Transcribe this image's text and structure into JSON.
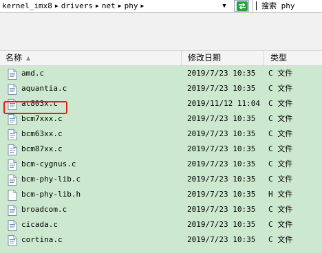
{
  "breadcrumb": [
    "kernel_imx8",
    "drivers",
    "net",
    "phy"
  ],
  "search": {
    "value": "搜索 phy"
  },
  "columns": {
    "name": "名称",
    "date": "修改日期",
    "type": "类型"
  },
  "files": [
    {
      "name": "amd.c",
      "date": "2019/7/23 10:35",
      "type": "C 文件",
      "icon": "c-file-icon"
    },
    {
      "name": "aquantia.c",
      "date": "2019/7/23 10:35",
      "type": "C 文件",
      "icon": "c-file-icon"
    },
    {
      "name": "at803x.c",
      "date": "2019/11/12 11:04",
      "type": "C 文件",
      "icon": "c-file-icon",
      "highlighted": true
    },
    {
      "name": "bcm7xxx.c",
      "date": "2019/7/23 10:35",
      "type": "C 文件",
      "icon": "c-file-icon"
    },
    {
      "name": "bcm63xx.c",
      "date": "2019/7/23 10:35",
      "type": "C 文件",
      "icon": "c-file-icon"
    },
    {
      "name": "bcm87xx.c",
      "date": "2019/7/23 10:35",
      "type": "C 文件",
      "icon": "c-file-icon"
    },
    {
      "name": "bcm-cygnus.c",
      "date": "2019/7/23 10:35",
      "type": "C 文件",
      "icon": "c-file-icon"
    },
    {
      "name": "bcm-phy-lib.c",
      "date": "2019/7/23 10:35",
      "type": "C 文件",
      "icon": "c-file-icon"
    },
    {
      "name": "bcm-phy-lib.h",
      "date": "2019/7/23 10:35",
      "type": "H 文件",
      "icon": "h-file-icon"
    },
    {
      "name": "broadcom.c",
      "date": "2019/7/23 10:35",
      "type": "C 文件",
      "icon": "c-file-icon"
    },
    {
      "name": "cicada.c",
      "date": "2019/7/23 10:35",
      "type": "C 文件",
      "icon": "c-file-icon"
    },
    {
      "name": "cortina.c",
      "date": "2019/7/23 10:35",
      "type": "C 文件",
      "icon": "c-file-icon"
    }
  ],
  "colors": {
    "list_background": "#cce8cf",
    "highlight_border": "#e02020",
    "refresh_green": "#2e9e3c"
  }
}
